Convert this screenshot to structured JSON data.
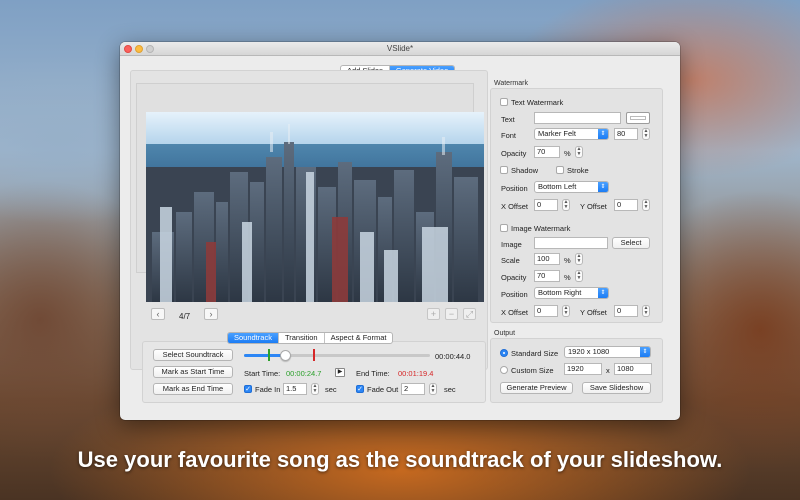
{
  "caption": "Use your favourite song as the soundtrack of your slideshow.",
  "window": {
    "title": "VSlide*"
  },
  "mode_tabs": [
    {
      "label": "Add Slides",
      "active": false
    },
    {
      "label": "Generate Video",
      "active": true
    }
  ],
  "preview": {
    "page_indicator": "4/7",
    "prev_icon": "chevron-left-icon",
    "next_icon": "chevron-right-icon",
    "add_icon": "plus-icon",
    "remove_icon": "minus-icon",
    "expand_icon": "expand-icon",
    "image_description_hidden": true
  },
  "audio_tabs": [
    {
      "label": "Soundtrack",
      "active": true
    },
    {
      "label": "Transition",
      "active": false
    },
    {
      "label": "Aspect & Format",
      "active": false
    }
  ],
  "soundtrack": {
    "select_button": "Select Soundtrack",
    "mark_start_button": "Mark as Start Time",
    "mark_end_button": "Mark as End Time",
    "duration": "00:00:44.0",
    "start_time_label": "Start Time:",
    "start_time": "00:00:24.7",
    "end_time_label": "End Time:",
    "end_time": "00:01:19.4",
    "fade_in_label": "Fade In",
    "fade_in_checked": true,
    "fade_in_value": "1.5",
    "fade_out_label": "Fade Out",
    "fade_out_checked": true,
    "fade_out_value": "2",
    "sec_unit": "sec",
    "start_color": "#2ca02c",
    "end_color": "#d62728"
  },
  "watermark": {
    "section_title": "Watermark",
    "text_watermark_label": "Text Watermark",
    "text_label": "Text",
    "text_value": "",
    "font_label": "Font",
    "font_value": "Marker Felt",
    "font_size": "80",
    "opacity_label": "Opacity",
    "opacity_value": "70",
    "percent": "%",
    "shadow_label": "Shadow",
    "stroke_label": "Stroke",
    "position_label": "Position",
    "position_value": "Bottom Left",
    "x_offset_label": "X Offset",
    "x_offset_value": "0",
    "y_offset_label": "Y Offset",
    "y_offset_value": "0",
    "image_watermark_label": "Image Watermark",
    "image_label": "Image",
    "image_value": "",
    "select_button": "Select",
    "scale_label": "Scale",
    "scale_value": "100",
    "img_opacity_label": "Opacity",
    "img_opacity_value": "70",
    "img_position_label": "Position",
    "img_position_value": "Bottom Right",
    "img_x_offset_label": "X Offset",
    "img_x_offset_value": "0",
    "img_y_offset_label": "Y Offset",
    "img_y_offset_value": "0"
  },
  "output": {
    "section_title": "Output",
    "standard_size_label": "Standard Size",
    "standard_size_value": "1920 x 1080",
    "custom_size_label": "Custom Size",
    "custom_width": "1920",
    "times": "x",
    "custom_height": "1080",
    "generate_preview_button": "Generate Preview",
    "save_slideshow_button": "Save Slideshow"
  }
}
